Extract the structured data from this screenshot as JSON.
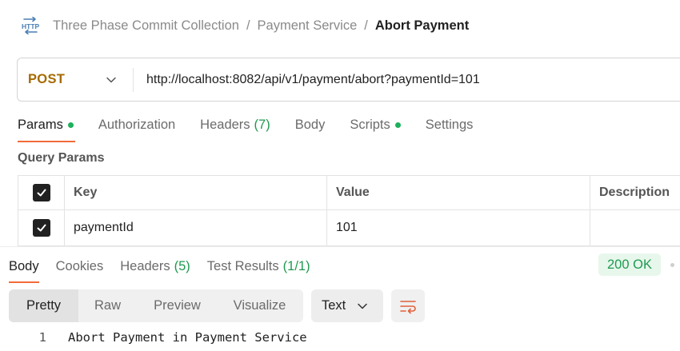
{
  "icons": {
    "http": "http-icon",
    "method_chevron": "chevron-down-icon",
    "format_chevron": "chevron-down-icon",
    "wrap": "wrap-lines-icon",
    "checkbox": "checkbox-checked-icon"
  },
  "colors": {
    "method": "#a56a00",
    "accent": "#f26b3a",
    "success": "#1eb05b",
    "status_bg": "#e7f7ec"
  },
  "breadcrumb": {
    "collection": "Three Phase Commit Collection",
    "separator": "/",
    "folder": "Payment Service",
    "request": "Abort Payment"
  },
  "request": {
    "method": "POST",
    "url": "http://localhost:8082/api/v1/payment/abort?paymentId=101"
  },
  "request_tabs": [
    {
      "label": "Params",
      "active": true,
      "dot": true
    },
    {
      "label": "Authorization"
    },
    {
      "label": "Headers",
      "count": "(7)"
    },
    {
      "label": "Body"
    },
    {
      "label": "Scripts",
      "dot": true
    },
    {
      "label": "Settings"
    }
  ],
  "query_params": {
    "title": "Query Params",
    "columns": [
      "Key",
      "Value",
      "Description"
    ],
    "rows": [
      {
        "checked": true,
        "key": "paymentId",
        "value": "101",
        "description": ""
      }
    ]
  },
  "response": {
    "tabs": [
      {
        "label": "Body",
        "active": true
      },
      {
        "label": "Cookies"
      },
      {
        "label": "Headers",
        "count": "(5)"
      },
      {
        "label": "Test Results",
        "count": "(1/1)"
      }
    ],
    "status": "200 OK",
    "view_modes": [
      "Pretty",
      "Raw",
      "Preview",
      "Visualize"
    ],
    "active_view": "Pretty",
    "format": "Text",
    "lines": [
      {
        "number": "1",
        "text": "Abort Payment in Payment Service"
      }
    ]
  }
}
